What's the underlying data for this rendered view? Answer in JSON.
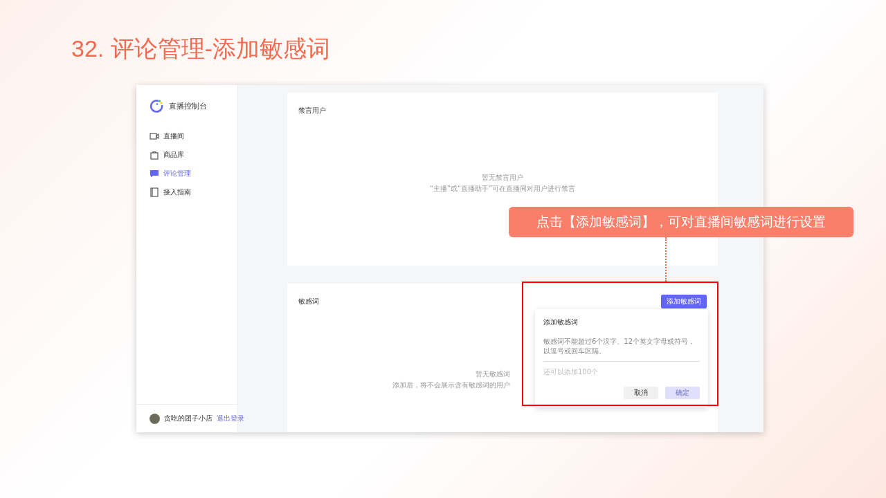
{
  "slide_title": "32. 评论管理-添加敏感词",
  "sidebar": {
    "brand": "直播控制台",
    "items": [
      {
        "label": "直播间",
        "selected": false
      },
      {
        "label": "商品库",
        "selected": false
      },
      {
        "label": "评论管理",
        "selected": true
      },
      {
        "label": "接入指南",
        "selected": false
      }
    ],
    "user": {
      "name": "贪吃的团子小店",
      "logout": "退出登录"
    }
  },
  "muted_users": {
    "title": "禁言用户",
    "empty_title": "暂无禁言用户",
    "empty_hint": "“主播”或“直播助手”可在直播间对用户进行禁言"
  },
  "sensitive_words": {
    "title": "敏感词",
    "add_button": "添加敏感词",
    "empty_title": "暂无敏感词",
    "empty_hint": "添加后，将不会展示含有敏感词的用户"
  },
  "dialog": {
    "title": "添加敏感词",
    "placeholder": "敏感词不能超过6个汉字、12个英文字母或符号，以逗号或回车区隔。",
    "remaining": "还可以添加100个",
    "buttons": [
      {
        "label": "取消",
        "kind": "cancel",
        "disabled": false
      },
      {
        "label": "确定",
        "kind": "confirm",
        "disabled": true
      }
    ]
  },
  "callout": "点击【添加敏感词】，可对直播间敏感词进行设置"
}
